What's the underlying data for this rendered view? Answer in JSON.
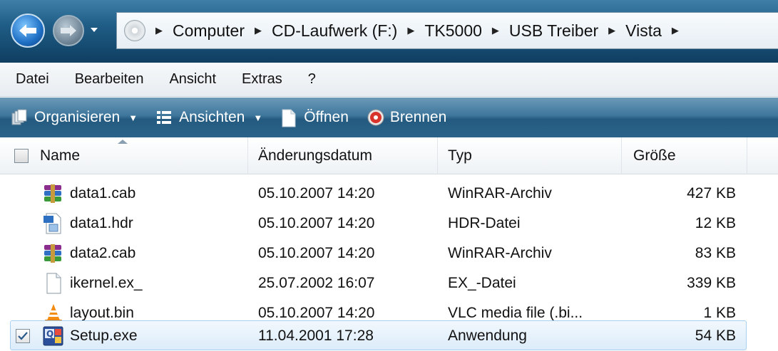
{
  "address": {
    "crumbs": [
      "Computer",
      "CD-Laufwerk (F:)",
      "TK5000",
      "USB Treiber",
      "Vista"
    ]
  },
  "menu": [
    "Datei",
    "Bearbeiten",
    "Ansicht",
    "Extras",
    "?"
  ],
  "commands": {
    "organize": "Organisieren",
    "views": "Ansichten",
    "open": "Öffnen",
    "burn": "Brennen"
  },
  "columns": {
    "name": "Name",
    "date": "Änderungsdatum",
    "type": "Typ",
    "size": "Größe"
  },
  "files": [
    {
      "name": "data1.cab",
      "date": "05.10.2007 14:20",
      "type": "WinRAR-Archiv",
      "size": "427 KB",
      "icon": "winrar-archive-icon"
    },
    {
      "name": "data1.hdr",
      "date": "05.10.2007 14:20",
      "type": "HDR-Datei",
      "size": "12 KB",
      "icon": "hdr-file-icon"
    },
    {
      "name": "data2.cab",
      "date": "05.10.2007 14:20",
      "type": "WinRAR-Archiv",
      "size": "83 KB",
      "icon": "winrar-archive-icon"
    },
    {
      "name": "ikernel.ex_",
      "date": "25.07.2002 16:07",
      "type": "EX_-Datei",
      "size": "339 KB",
      "icon": "generic-file-icon"
    },
    {
      "name": "layout.bin",
      "date": "05.10.2007 14:20",
      "type": "VLC media file (.bi...",
      "size": "1 KB",
      "icon": "vlc-cone-icon"
    },
    {
      "name": "Setup.exe",
      "date": "11.04.2001 17:28",
      "type": "Anwendung",
      "size": "54 KB",
      "icon": "setup-app-icon",
      "selected": true
    }
  ],
  "colors": {
    "addressbar_dark": "#0f3e61",
    "commandbar": "#245a80",
    "selection": "#dcecfa"
  }
}
